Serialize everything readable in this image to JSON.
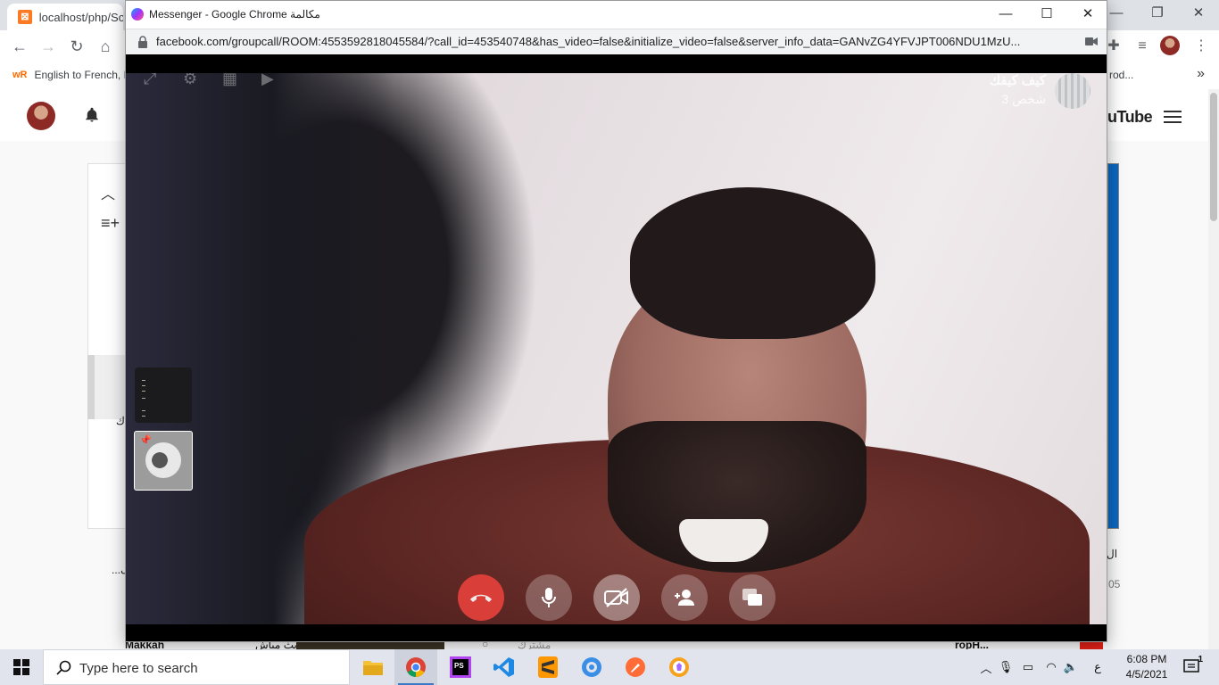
{
  "bg_browser": {
    "tab_title": "localhost/php/Sc",
    "bookmark_label": "English to French, It",
    "bookmark_right": "rod...",
    "bookmark_more": "»",
    "page": {
      "logo_text": "uTube",
      "frag_left_mid": "ك",
      "frag_left_bottom": "...ف",
      "frag_right_1": "ال",
      "frag_right_2": "05",
      "strip_1": "Makkah",
      "strip_2": "بث مباش",
      "strip_3": "القناة القرآن الكريم",
      "strip_4": "مشترك",
      "strip_5": "ropH..."
    }
  },
  "popup": {
    "title": "Messenger - Google Chrome مكالمة",
    "url": "facebook.com/groupcall/ROOM:4553592818045584/?call_id=453540748&has_video=false&initialize_video=false&server_info_data=GANvZG4YFVJPT006NDU1MzU...",
    "group_name": "كيف كيفك",
    "group_count": "3 شخص"
  },
  "taskbar": {
    "search_placeholder": "Type here to search",
    "time": "6:08 PM",
    "date": "4/5/2021",
    "lang": "ع",
    "notification_count": "1"
  },
  "colors": {
    "end_call": "#e8413b",
    "taskbar": "#e1e4ec",
    "accent": "#3b78c6"
  }
}
